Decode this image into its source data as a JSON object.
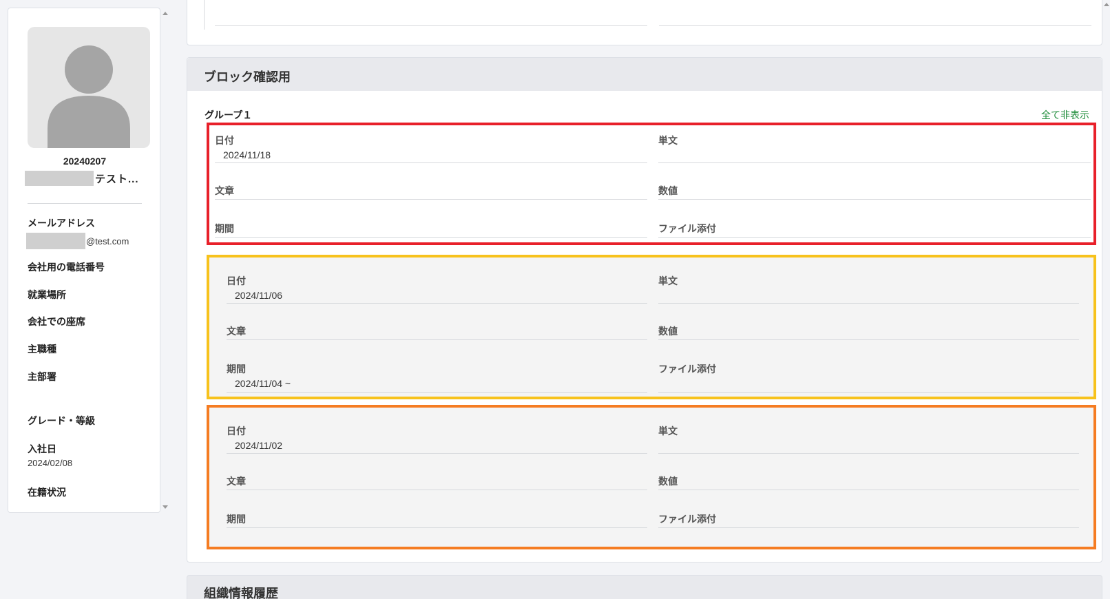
{
  "profile": {
    "employee_id": "20240207",
    "name_visible": "テスト...",
    "email_label": "メールアドレス",
    "email_domain": "@test.com",
    "phone_label": "会社用の電話番号",
    "workplace_label": "就業場所",
    "seat_label": "会社での座席",
    "job_label": "主職種",
    "dept_label": "主部署",
    "grade_label": "グレード・等級",
    "join_label": "入社日",
    "join_value": "2024/02/08",
    "status_label": "在籍状況"
  },
  "block": {
    "title": "ブロック確認用",
    "group_title": "グループ１",
    "hide_all": "全て非表示",
    "records": [
      {
        "border_color": "#e8202a",
        "date_label": "日付",
        "date_value": "2024/11/18",
        "text_label": "単文",
        "text_value": "",
        "sentence_label": "文章",
        "sentence_value": "",
        "number_label": "数値",
        "number_value": "",
        "period_label": "期間",
        "period_value": "",
        "file_label": "ファイル添付",
        "file_value": ""
      },
      {
        "border_color": "#f7c21c",
        "date_label": "日付",
        "date_value": "2024/11/06",
        "text_label": "単文",
        "text_value": "",
        "sentence_label": "文章",
        "sentence_value": "",
        "number_label": "数値",
        "number_value": "",
        "period_label": "期間",
        "period_value": "2024/11/04 ~",
        "file_label": "ファイル添付",
        "file_value": ""
      },
      {
        "border_color": "#f57c22",
        "date_label": "日付",
        "date_value": "2024/11/02",
        "text_label": "単文",
        "text_value": "",
        "sentence_label": "文章",
        "sentence_value": "",
        "number_label": "数値",
        "number_value": "",
        "period_label": "期間",
        "period_value": "",
        "file_label": "ファイル添付",
        "file_value": ""
      }
    ]
  },
  "org": {
    "title": "組織情報履歴"
  },
  "icons": {
    "avatar": "user-silhouette-icon",
    "scroll_up": "scroll-up-arrow-icon",
    "scroll_down": "scroll-down-arrow-icon"
  }
}
